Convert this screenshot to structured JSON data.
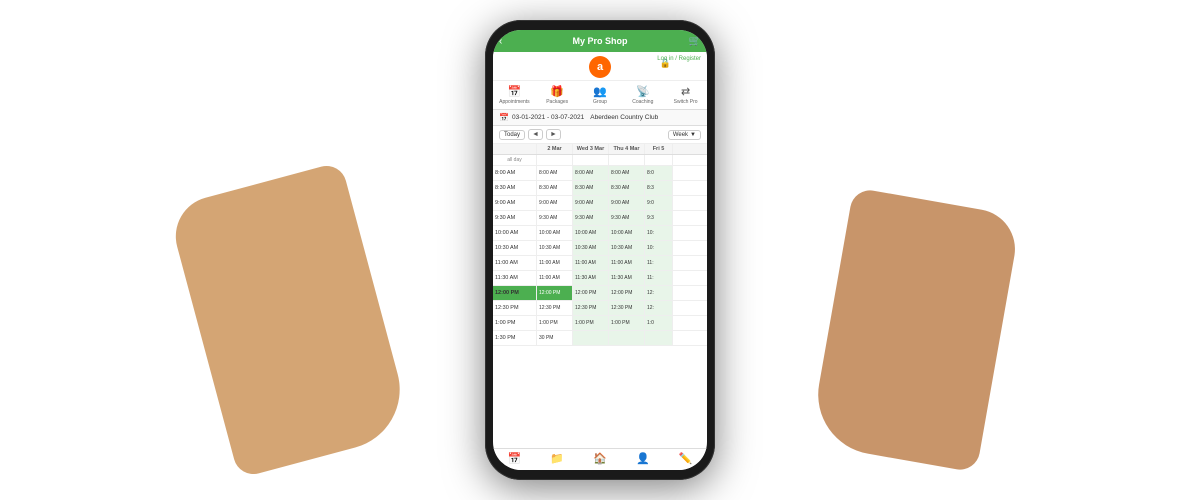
{
  "app": {
    "title": "My Pro Shop",
    "header": {
      "back_icon": "‹",
      "title": "My Pro Shop",
      "lock_icon": "🔒"
    },
    "logo": {
      "letter": "a",
      "login_label": "Log in /\nRegister"
    },
    "nav_tabs": [
      {
        "label": "Appointments",
        "icon": "📅"
      },
      {
        "label": "Packages",
        "icon": "🎁"
      },
      {
        "label": "Group",
        "icon": "👥"
      },
      {
        "label": "Coaching",
        "icon": "📡"
      },
      {
        "label": "Switch Pro",
        "icon": "⇄"
      }
    ],
    "date_range": "03-01-2021 - 03-07-2021",
    "club_name": "Aberdeen Country Club",
    "controls": {
      "today_label": "Today",
      "prev_icon": "◄",
      "next_icon": "►",
      "view_label": "Week",
      "dropdown_icon": "▼"
    },
    "calendar": {
      "col_headers": [
        "",
        "2 Mar",
        "Wed 3 Mar",
        "Thu 4 Mar",
        "Fri 5"
      ],
      "allday_label": "all day",
      "time_slots": [
        {
          "time": "8:00 AM",
          "cols": [
            "8:00 AM",
            "8:00 AM",
            "8:00 AM",
            "8:0"
          ]
        },
        {
          "time": "8:30 AM",
          "cols": [
            "8:30 AM",
            "8:30 AM",
            "8:30 AM",
            "8:3"
          ]
        },
        {
          "time": "9:00 AM",
          "cols": [
            "9:00 AM",
            "9:00 AM",
            "9:00 AM",
            "9:0"
          ]
        },
        {
          "time": "9:30 AM",
          "cols": [
            "9:30 AM",
            "9:30 AM",
            "9:30 AM",
            "9:3"
          ]
        },
        {
          "time": "10:00 AM",
          "cols": [
            "10:00 AM",
            "10:00 AM",
            "10:00 AM",
            "10:"
          ]
        },
        {
          "time": "10:30 AM",
          "cols": [
            "10:30 AM",
            "10:30 AM",
            "10:30 AM",
            "10:"
          ]
        },
        {
          "time": "11:00 AM",
          "cols": [
            "11:00 AM",
            "11:00 AM",
            "11:00 AM",
            "11:"
          ]
        },
        {
          "time": "11:30 AM",
          "cols": [
            "11:00 AM",
            "11:30 AM",
            "11:30 AM",
            "11:"
          ]
        },
        {
          "time": "12:00 PM",
          "cols": [
            "12:00 PM",
            "12:00 PM",
            "12:00 PM",
            "12:"
          ],
          "current": true
        },
        {
          "time": "12:30 PM",
          "cols": [
            "12:30 PM",
            "12:30 PM",
            "12:30 PM",
            "12:"
          ]
        },
        {
          "time": "1:00 PM",
          "cols": [
            "1:00 PM",
            "1:00 PM",
            "1:00 PM",
            "1:0"
          ]
        },
        {
          "time": "1:30 PM",
          "cols": [
            "30 PM",
            "",
            "",
            ""
          ]
        }
      ]
    },
    "bottom_nav": [
      {
        "label": "Calendar",
        "icon": "📅"
      },
      {
        "label": "Folder",
        "icon": "📁"
      },
      {
        "label": "Home",
        "icon": "🏠"
      },
      {
        "label": "Person",
        "icon": "👤"
      },
      {
        "label": "Edit",
        "icon": "✏️"
      }
    ]
  }
}
